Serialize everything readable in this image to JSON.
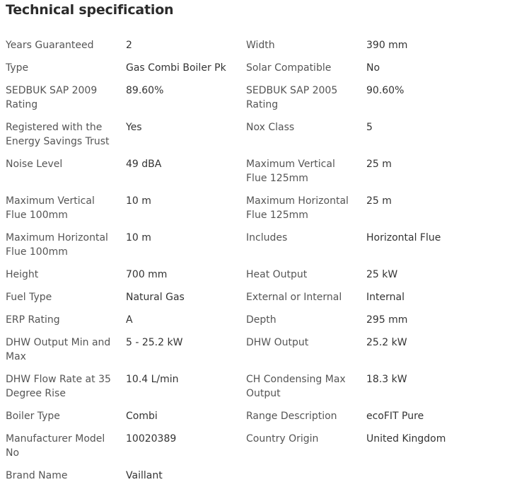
{
  "title": "Technical specification",
  "rows": [
    {
      "l1": "Years Guaranteed",
      "v1": "2",
      "l2": "Width",
      "v2": "390 mm"
    },
    {
      "l1": "Type",
      "v1": "Gas Combi Boiler Pk",
      "l2": "Solar Compatible",
      "v2": "No"
    },
    {
      "l1": "SEDBUK SAP 2009 Rating",
      "v1": "89.60%",
      "l2": "SEDBUK SAP 2005 Rating",
      "v2": "90.60%"
    },
    {
      "l1": "Registered with the Energy Savings Trust",
      "v1": "Yes",
      "l2": "Nox Class",
      "v2": "5"
    },
    {
      "l1": "Noise Level",
      "v1": "49 dBA",
      "l2": "Maximum Vertical Flue 125mm",
      "v2": "25 m"
    },
    {
      "l1": "Maximum Vertical Flue 100mm",
      "v1": "10 m",
      "l2": "Maximum Horizontal Flue 125mm",
      "v2": "25 m"
    },
    {
      "l1": "Maximum Horizontal Flue 100mm",
      "v1": "10 m",
      "l2": "Includes",
      "v2": "Horizontal Flue"
    },
    {
      "l1": "Height",
      "v1": "700 mm",
      "l2": "Heat Output",
      "v2": "25 kW"
    },
    {
      "l1": "Fuel Type",
      "v1": "Natural Gas",
      "l2": "External or Internal",
      "v2": "Internal"
    },
    {
      "l1": "ERP Rating",
      "v1": "A",
      "l2": "Depth",
      "v2": "295 mm"
    },
    {
      "l1": "DHW Output Min and Max",
      "v1": "5 - 25.2 kW",
      "l2": "DHW Output",
      "v2": "25.2 kW"
    },
    {
      "l1": "DHW Flow Rate at 35 Degree Rise",
      "v1": "10.4 L/min",
      "l2": "CH Condensing Max Output",
      "v2": "18.3 kW"
    },
    {
      "l1": "Boiler Type",
      "v1": "Combi",
      "l2": "Range Description",
      "v2": "ecoFIT Pure"
    },
    {
      "l1": "Manufacturer Model No",
      "v1": "10020389",
      "l2": "Country Origin",
      "v2": "United Kingdom"
    },
    {
      "l1": "Brand Name",
      "v1": "Vaillant",
      "l2": "",
      "v2": ""
    }
  ]
}
